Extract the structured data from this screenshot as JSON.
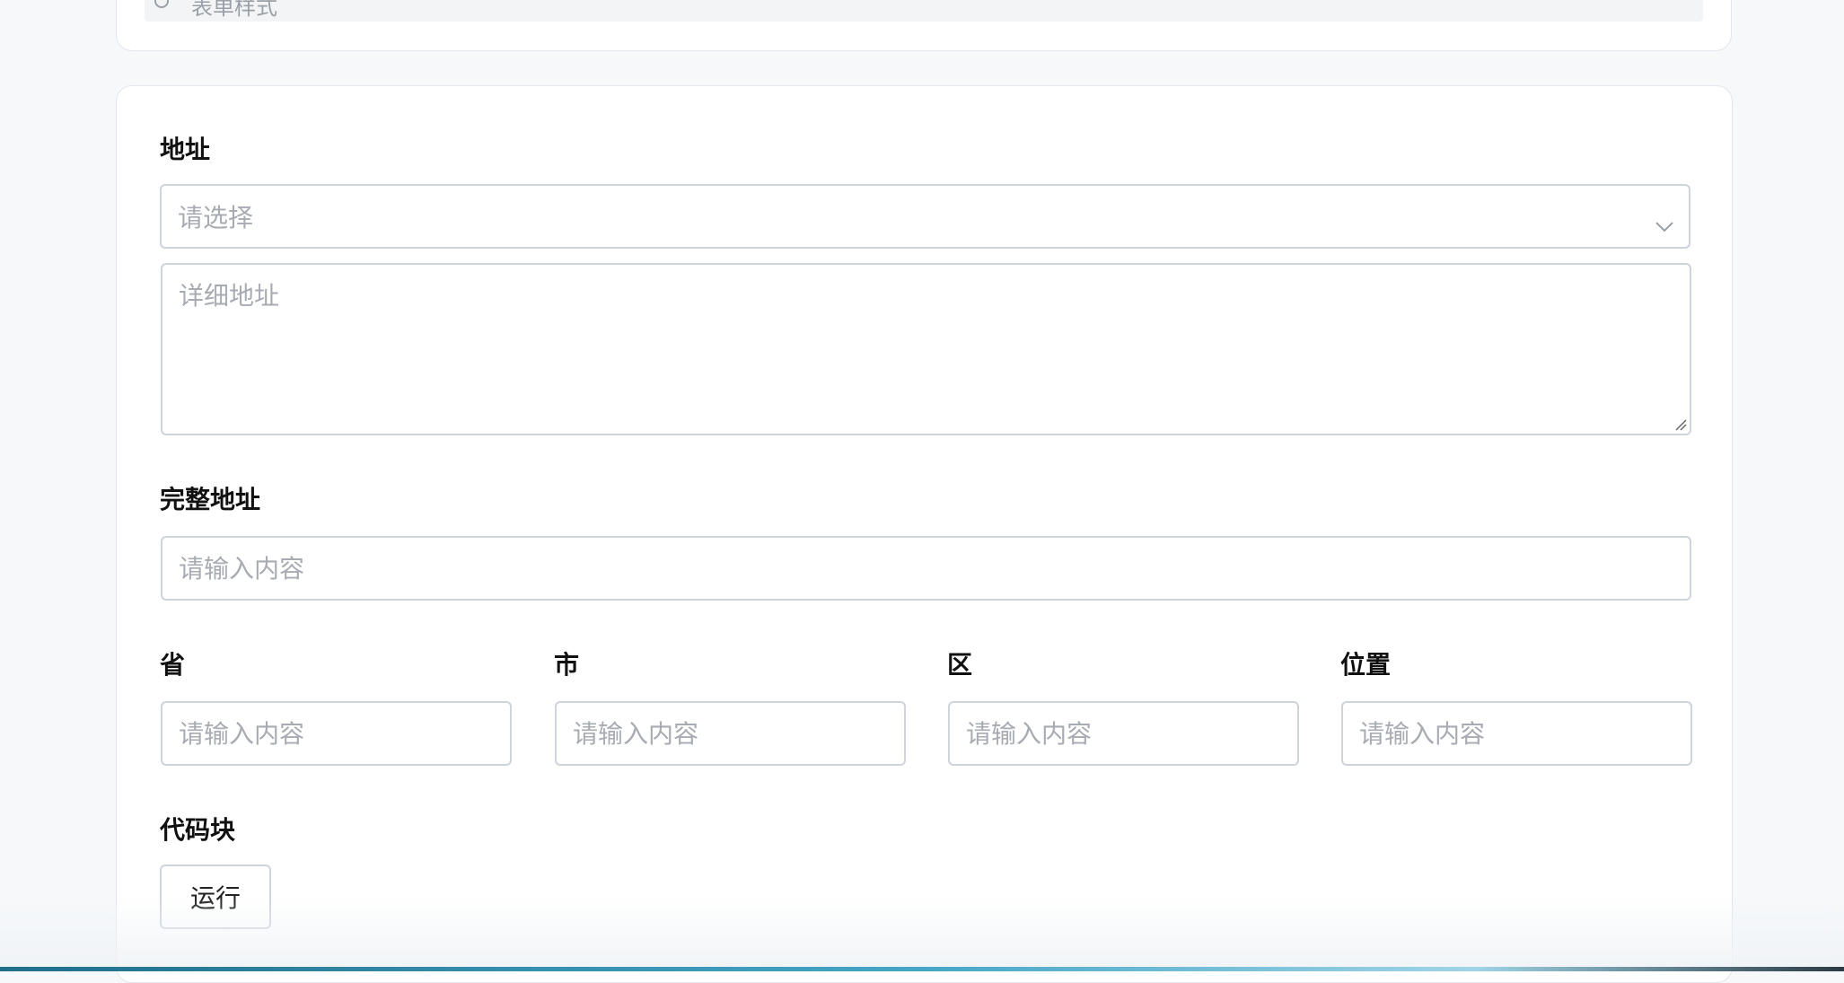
{
  "top": {
    "banner_label": "表单样式"
  },
  "address": {
    "label": "地址",
    "select_placeholder": "请选择",
    "detail_placeholder": "详细地址"
  },
  "full_address": {
    "label": "完整地址",
    "placeholder": "请输入内容"
  },
  "region_fields": [
    {
      "label": "省",
      "placeholder": "请输入内容"
    },
    {
      "label": "市",
      "placeholder": "请输入内容"
    },
    {
      "label": "区",
      "placeholder": "请输入内容"
    },
    {
      "label": "位置",
      "placeholder": "请输入内容"
    }
  ],
  "code_block": {
    "label": "代码块",
    "run_label": "运行"
  },
  "icons": {
    "select": "chevron-down-icon",
    "textarea": "resize-handle-icon",
    "banner": "form-style-icon"
  },
  "colors": {
    "page_bg": "#f6f8fa",
    "border": "#cfd3dc",
    "placeholder": "#a8abb2",
    "accent_bar": "#45a6c7"
  }
}
